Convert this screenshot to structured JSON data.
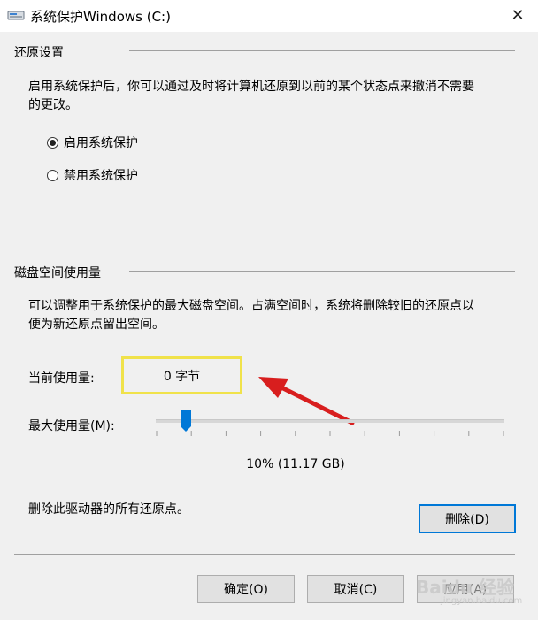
{
  "window": {
    "title": "系统保护Windows (C:)",
    "close_glyph": "✕"
  },
  "restore_settings": {
    "group_label": "还原设置",
    "description_line1": "启用系统保护后，你可以通过及时将计算机还原到以前的某个状态点来撤消不需要",
    "description_line2": "的更改。",
    "options": [
      {
        "label": "启用系统保护",
        "checked": true
      },
      {
        "label": "禁用系统保护",
        "checked": false
      }
    ]
  },
  "disk_usage": {
    "group_label": "磁盘空间使用量",
    "description_line1": "可以调整用于系统保护的最大磁盘空间。占满空间时，系统将删除较旧的还原点以",
    "description_line2": "便为新还原点留出空间。",
    "current_label": "当前使用量:",
    "current_value": "0 字节",
    "max_label": "最大使用量(M):",
    "max_percent": 0.1,
    "max_value_text": "10% (11.17 GB)",
    "delete_description": "删除此驱动器的所有还原点。",
    "delete_label": "删除(D)"
  },
  "footer": {
    "ok_label": "确定(O)",
    "cancel_label": "取消(C)",
    "apply_label": "应用(A)"
  },
  "watermark": {
    "text": "Baidu 经验",
    "subtext": "jingyan.baidu.com"
  },
  "colors": {
    "highlight_box": "#f0e24a",
    "arrow": "#e02020",
    "slider_thumb": "#0078d7"
  }
}
